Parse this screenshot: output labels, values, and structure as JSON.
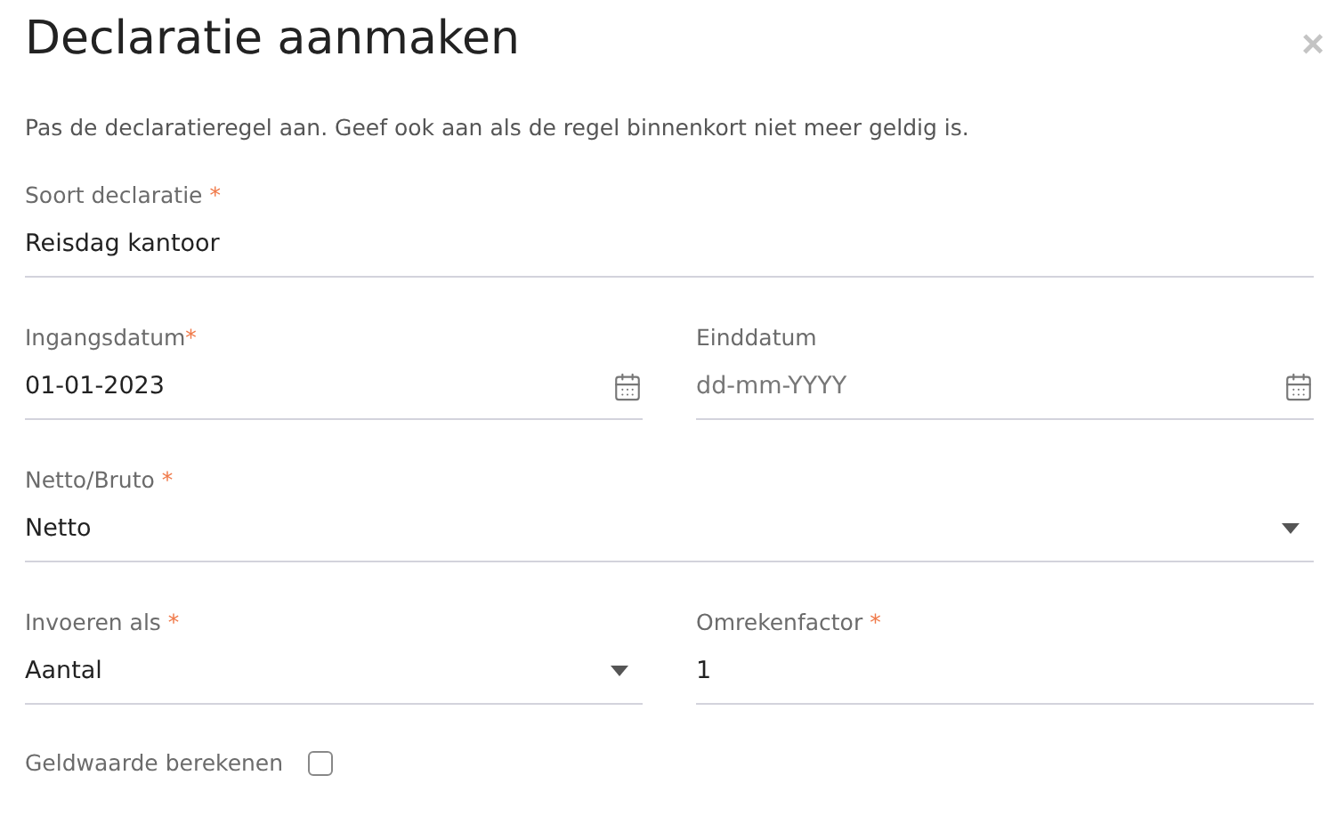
{
  "dialog": {
    "title": "Declaratie aanmaken",
    "close": "×",
    "intro": "Pas de declaratieregel aan. Geef ook aan als de regel binnenkort niet meer geldig is."
  },
  "rows": [
    {
      "fields": [
        {
          "kind": "text",
          "label": "Soort declaratie",
          "mark": " *",
          "value": "Reisdag kantoor"
        }
      ]
    },
    {
      "fields": [
        {
          "kind": "date",
          "label": "Ingangsdatum",
          "mark": "*",
          "value": "01-01-2023"
        },
        {
          "kind": "date",
          "label": "Einddatum",
          "placeholder": "dd-mm-YYYY"
        }
      ]
    },
    {
      "fields": [
        {
          "kind": "select",
          "label": "Netto/Bruto",
          "mark": " *",
          "value": "Netto"
        }
      ]
    },
    {
      "fields": [
        {
          "kind": "select",
          "label": "Invoeren als",
          "mark": " *",
          "value": "Aantal"
        },
        {
          "kind": "text",
          "label": "Omrekenfactor",
          "mark": " *",
          "value": "1"
        }
      ]
    }
  ],
  "checkbox": {
    "label": "Geldwaarde berekenen",
    "checked": false
  }
}
